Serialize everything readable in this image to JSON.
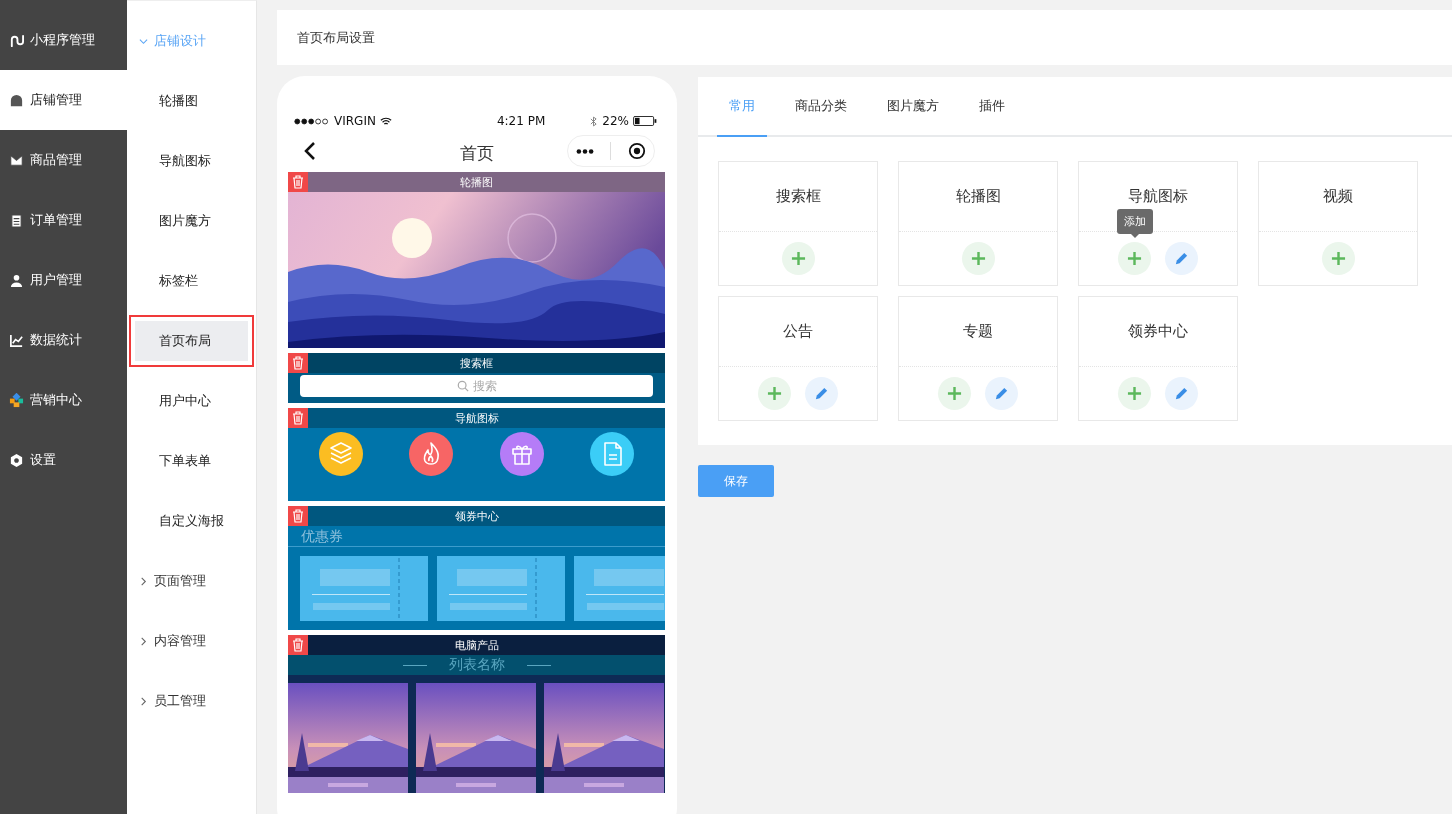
{
  "sidebar": {
    "items": [
      {
        "label": "小程序管理",
        "selected": false
      },
      {
        "label": "店铺管理",
        "selected": true
      },
      {
        "label": "商品管理",
        "selected": false
      },
      {
        "label": "订单管理",
        "selected": false
      },
      {
        "label": "用户管理",
        "selected": false
      },
      {
        "label": "数据统计",
        "selected": false
      },
      {
        "label": "营销中心",
        "selected": false
      },
      {
        "label": "设置",
        "selected": false
      }
    ]
  },
  "submenu": {
    "groups": [
      {
        "label": "店铺设计",
        "expanded": true,
        "children": [
          {
            "label": "轮播图",
            "selected": false
          },
          {
            "label": "导航图标",
            "selected": false
          },
          {
            "label": "图片魔方",
            "selected": false
          },
          {
            "label": "标签栏",
            "selected": false
          },
          {
            "label": "首页布局",
            "selected": true
          },
          {
            "label": "用户中心",
            "selected": false
          },
          {
            "label": "下单表单",
            "selected": false
          },
          {
            "label": "自定义海报",
            "selected": false
          }
        ]
      },
      {
        "label": "页面管理",
        "expanded": false
      },
      {
        "label": "内容管理",
        "expanded": false
      },
      {
        "label": "员工管理",
        "expanded": false
      }
    ]
  },
  "header": {
    "title": "首页布局设置"
  },
  "phone": {
    "status_bar": {
      "carrier": "VIRGIN",
      "time": "4:21 PM",
      "battery": "22%"
    },
    "nav_title": "首页",
    "modules": [
      {
        "kind": "banner",
        "label": "轮播图"
      },
      {
        "kind": "search",
        "label": "搜索框",
        "placeholder": "搜索"
      },
      {
        "kind": "nav",
        "label": "导航图标",
        "icons": [
          {
            "color": "#fbbd22"
          },
          {
            "color": "#f76565"
          },
          {
            "color": "#b57cf7"
          },
          {
            "color": "#3bcdf7"
          }
        ]
      },
      {
        "kind": "coupon",
        "label": "领券中心",
        "title": "优惠券"
      },
      {
        "kind": "product_list",
        "label": "电脑产品",
        "title": "列表名称"
      }
    ]
  },
  "panel": {
    "tabs": [
      {
        "label": "常用",
        "selected": true
      },
      {
        "label": "商品分类",
        "selected": false
      },
      {
        "label": "图片魔方",
        "selected": false
      },
      {
        "label": "插件",
        "selected": false
      }
    ],
    "components": [
      {
        "label": "搜索框",
        "editable": false
      },
      {
        "label": "轮播图",
        "editable": false
      },
      {
        "label": "导航图标",
        "editable": true,
        "tooltip": "添加"
      },
      {
        "label": "视频",
        "editable": false
      },
      {
        "label": "公告",
        "editable": true
      },
      {
        "label": "专题",
        "editable": true
      },
      {
        "label": "领券中心",
        "editable": true
      }
    ]
  },
  "save_button": "保存"
}
